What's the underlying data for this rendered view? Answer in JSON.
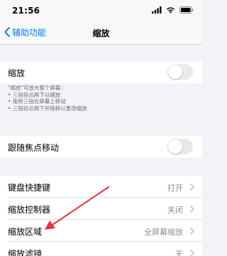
{
  "status_bar": {
    "time": "21:56",
    "icons": [
      "signal-icon",
      "wifi-icon",
      "battery-icon"
    ]
  },
  "nav": {
    "back_label": "辅助功能",
    "title": "缩放"
  },
  "zoom": {
    "label": "缩放",
    "enabled": false
  },
  "zoom_footnote": [
    "\"缩放\"可放大整个屏幕：",
    "• 三指轻点两下以缩放",
    "• 拖移三指在屏幕上移动",
    "• 三指轻点两下并拖移以更改缩放"
  ],
  "follow_focus": {
    "label": "跟随焦点移动",
    "enabled": false
  },
  "settings_list": [
    {
      "label": "键盘快捷键",
      "value": "打开"
    },
    {
      "label": "缩放控制器",
      "value": "关闭"
    },
    {
      "label": "缩放区域",
      "value": "全屏幕缩放"
    },
    {
      "label": "缩放滤镜",
      "value": "无"
    }
  ],
  "annotation": {
    "arrow_color": "#e8333a"
  },
  "colors": {
    "accent": "#007aff",
    "background": "#f2f2f7",
    "toggle_off": "#e9e9eb"
  }
}
